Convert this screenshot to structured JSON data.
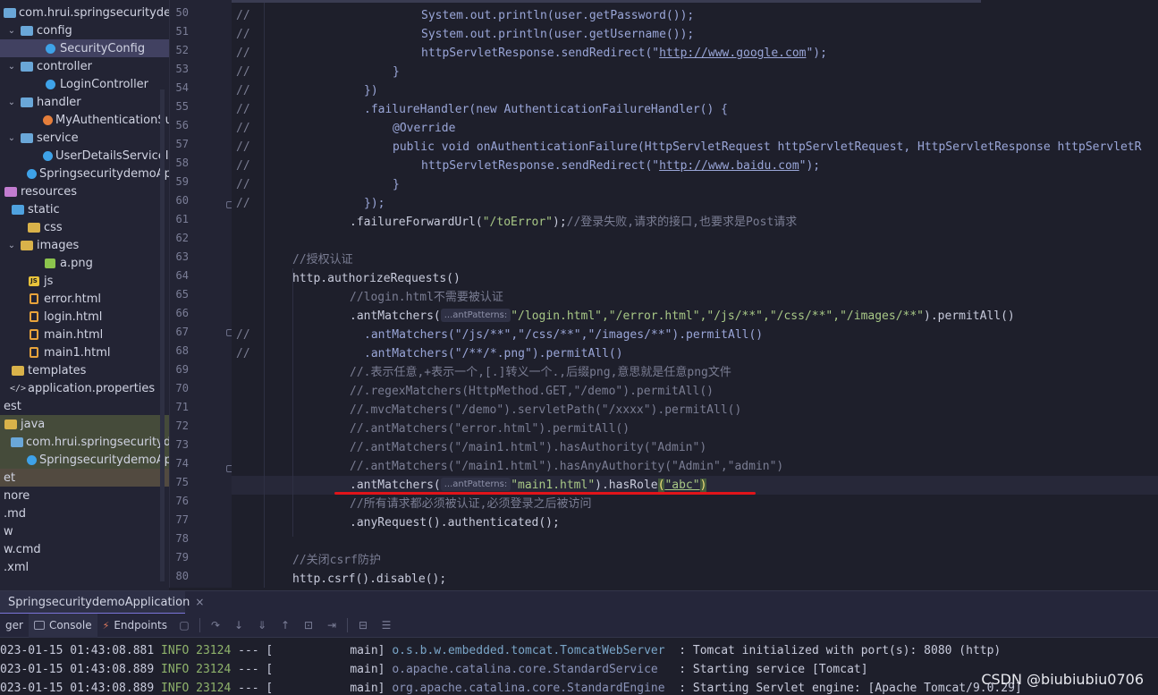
{
  "project_tree": [
    {
      "label": "com.hrui.springsecuritydemo",
      "indent": 0,
      "chev": "",
      "icon": "package-icon",
      "state": ""
    },
    {
      "label": "config",
      "indent": 8,
      "chev": "v",
      "icon": "package-icon",
      "state": ""
    },
    {
      "label": "SecurityConfig",
      "indent": 44,
      "chev": "",
      "icon": "class-icon",
      "state": "sel"
    },
    {
      "label": "controller",
      "indent": 8,
      "chev": "v",
      "icon": "package-icon",
      "state": ""
    },
    {
      "label": "LoginController",
      "indent": 44,
      "chev": "",
      "icon": "class-icon",
      "state": ""
    },
    {
      "label": "handler",
      "indent": 8,
      "chev": "v",
      "icon": "package-icon",
      "state": ""
    },
    {
      "label": "MyAuthenticationSuc",
      "indent": 44,
      "chev": "",
      "icon": "java-file-icon",
      "state": ""
    },
    {
      "label": "service",
      "indent": 8,
      "chev": "v",
      "icon": "package-icon",
      "state": ""
    },
    {
      "label": "UserDetailsServiceIn",
      "indent": 44,
      "chev": "",
      "icon": "class-icon",
      "state": ""
    },
    {
      "label": "SpringsecuritydemoApp",
      "indent": 26,
      "chev": "",
      "icon": "spring-class-icon",
      "state": ""
    },
    {
      "label": "resources",
      "indent": 0,
      "chev": "",
      "icon": "resources-folder-icon",
      "state": ""
    },
    {
      "label": "static",
      "indent": 8,
      "chev": "",
      "icon": "web-folder-icon",
      "state": ""
    },
    {
      "label": "css",
      "indent": 26,
      "chev": "",
      "icon": "folder-icon",
      "state": ""
    },
    {
      "label": "images",
      "indent": 8,
      "chev": "v",
      "icon": "folder-icon",
      "state": ""
    },
    {
      "label": "a.png",
      "indent": 44,
      "chev": "",
      "icon": "image-file-icon",
      "state": ""
    },
    {
      "label": "js",
      "indent": 26,
      "chev": "",
      "icon": "js-folder-icon",
      "state": ""
    },
    {
      "label": "error.html",
      "indent": 26,
      "chev": "",
      "icon": "html-file-icon",
      "state": ""
    },
    {
      "label": "login.html",
      "indent": 26,
      "chev": "",
      "icon": "html-file-icon",
      "state": ""
    },
    {
      "label": "main.html",
      "indent": 26,
      "chev": "",
      "icon": "html-file-icon",
      "state": ""
    },
    {
      "label": "main1.html",
      "indent": 26,
      "chev": "",
      "icon": "html-file-icon",
      "state": ""
    },
    {
      "label": "templates",
      "indent": 8,
      "chev": "",
      "icon": "folder-icon",
      "state": ""
    },
    {
      "label": "application.properties",
      "indent": 8,
      "chev": "",
      "icon": "properties-file-icon",
      "state": ""
    },
    {
      "label": "est",
      "indent": 0,
      "chev": "",
      "icon": "",
      "state": ""
    },
    {
      "label": "java",
      "indent": 0,
      "chev": "",
      "icon": "folder-icon",
      "state": "green"
    },
    {
      "label": "com.hrui.springsecuritydem",
      "indent": 8,
      "chev": "",
      "icon": "package-icon",
      "state": "green"
    },
    {
      "label": "SpringsecuritydemoApp",
      "indent": 26,
      "chev": "",
      "icon": "class-icon",
      "state": "green"
    },
    {
      "label": "et",
      "indent": 0,
      "chev": "",
      "icon": "",
      "state": "brown"
    },
    {
      "label": "nore",
      "indent": 0,
      "chev": "",
      "icon": "",
      "state": ""
    },
    {
      "label": ".md",
      "indent": 0,
      "chev": "",
      "icon": "",
      "state": ""
    },
    {
      "label": "w",
      "indent": 0,
      "chev": "",
      "icon": "",
      "state": ""
    },
    {
      "label": "w.cmd",
      "indent": 0,
      "chev": "",
      "icon": "",
      "state": ""
    },
    {
      "label": ".xml",
      "indent": 0,
      "chev": "",
      "icon": "",
      "state": ""
    }
  ],
  "line_numbers": [
    "50",
    "51",
    "52",
    "53",
    "54",
    "55",
    "56",
    "57",
    "58",
    "59",
    "60",
    "61",
    "62",
    "63",
    "64",
    "65",
    "66",
    "67",
    "68",
    "69",
    "70",
    "71",
    "72",
    "73",
    "74",
    "75",
    "76",
    "77",
    "78",
    "79",
    "80"
  ],
  "code": {
    "l50": {
      "c": "//",
      "t": "System.out.println(user.getPassword());"
    },
    "l51": {
      "c": "//",
      "t": "System.out.println(user.getUsername());"
    },
    "l52": {
      "c": "//",
      "t": "httpServletResponse.sendRedirect(\"",
      "u": "http://www.google.com",
      "e": "\");"
    },
    "l53": {
      "c": "//",
      "t": "}"
    },
    "l54": {
      "c": "//",
      "t": "})"
    },
    "l55": {
      "c": "//",
      "t": ".failureHandler(new AuthenticationFailureHandler() {"
    },
    "l56": {
      "c": "//",
      "t": "@Override"
    },
    "l57": {
      "c": "//",
      "t": "public void onAuthenticationFailure(HttpServletRequest httpServletRequest, HttpServletResponse httpServletR"
    },
    "l58": {
      "c": "//",
      "t": "httpServletResponse.sendRedirect(\"",
      "u": "http://www.baidu.com",
      "e": "\");"
    },
    "l59": {
      "c": "//",
      "t": "}"
    },
    "l60": {
      "c": "//",
      "t": "});"
    },
    "l61": {
      "a": ".failureForwardUrl(",
      "s": "\"/toError\"",
      "b": ");",
      "cm": "//登录失败,请求的接口,也要求是Post请求"
    },
    "l63": {
      "cm": "//授权认证"
    },
    "l64": {
      "a": "http.authorizeRequests()"
    },
    "l65": {
      "cm": "//login.html不需要被认证"
    },
    "l66": {
      "a": ".antMatchers(",
      "hint": "...antPatterns:",
      "s": "\"/login.html\",\"/error.html\",\"/js/**\",\"/css/**\",\"/images/**\"",
      "b": ").permitAll()"
    },
    "l67": {
      "c": "//",
      "t": ".antMatchers(\"/js/**\",\"/css/**\",\"/images/**\").permitAll()"
    },
    "l68": {
      "c": "//",
      "t": ".antMatchers(\"/**/*.png\").permitAll()"
    },
    "l69": {
      "cm": "//.表示任意,+表示一个,[.]转义一个.,后缀png,意思就是任意png文件"
    },
    "l70": {
      "cm": "//.regexMatchers(HttpMethod.GET,\"/demo\").permitAll()"
    },
    "l71": {
      "cm": "//.mvcMatchers(\"/demo\").servletPath(\"/xxxx\").permitAll()"
    },
    "l72": {
      "cm": "//.antMatchers(\"error.html\").permitAll()"
    },
    "l73": {
      "cm": "//.antMatchers(\"/main1.html\").hasAuthority(\"Admin\")"
    },
    "l74": {
      "cm": "//.antMatchers(\"/main1.html\").hasAnyAuthority(\"Admin\",\"admin\")"
    },
    "l75": {
      "a": ".antMatchers(",
      "hint": "...antPatterns:",
      "s": "\"main1.html\"",
      "b": ").hasRole",
      "p1": "(",
      "s2": "\"abc\"",
      "p2": ")"
    },
    "l76": {
      "cm": "//所有请求都必须被认证,必须登录之后被访问"
    },
    "l77": {
      "a": ".anyRequest().authenticated();"
    },
    "l79": {
      "cm": "//关闭csrf防护"
    },
    "l80": {
      "a": "http.csrf().disable();"
    }
  },
  "run_tab": {
    "label": "SpringsecuritydemoApplication",
    "close": "×"
  },
  "tool_tabs": {
    "debugger": "ger",
    "console": "Console",
    "endpoints": "Endpoints"
  },
  "log_lines": [
    {
      "ts": "023-01-15 01:43:08.881",
      "lvl": "INFO",
      "pid": "23124",
      "sep": "--- [",
      "thread": "           main]",
      "logger": "o.s.b.w.embedded.tomcat.TomcatWebServer ",
      "msg": " : Tomcat initialized with port(s): 8080 (http)"
    },
    {
      "ts": "023-01-15 01:43:08.889",
      "lvl": "INFO",
      "pid": "23124",
      "sep": "--- [",
      "thread": "           main]",
      "logger": "o.apache.catalina.core.StandardService  ",
      "msg": " : Starting service [Tomcat]"
    },
    {
      "ts": "023-01-15 01:43:08.889",
      "lvl": "INFO",
      "pid": "23124",
      "sep": "--- [",
      "thread": "           main]",
      "logger": "org.apache.catalina.core.StandardEngine ",
      "msg": " : Starting Servlet engine: [Apache Tomcat/9.0.29]"
    }
  ],
  "watermark": "CSDN @biubiubiu0706"
}
